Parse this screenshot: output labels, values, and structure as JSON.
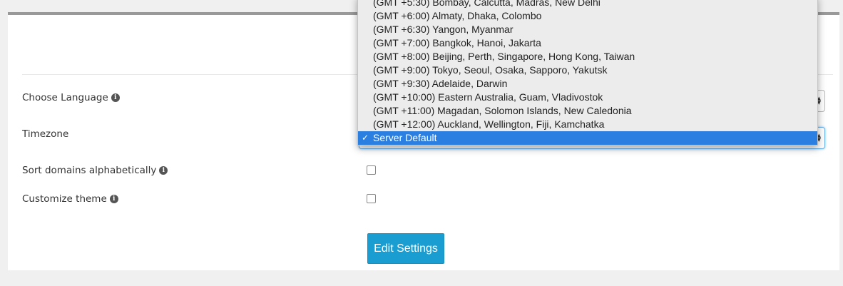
{
  "settings": {
    "language_label": "Choose Language",
    "timezone_label": "Timezone",
    "sort_domains_label": "Sort domains alphabetically",
    "customize_theme_label": "Customize theme",
    "sort_domains_checked": false,
    "customize_theme_checked": false,
    "submit_label": "Edit Settings"
  },
  "timezone_dropdown": {
    "options": [
      "(GMT +5:30) Bombay, Calcutta, Madras, New Delhi",
      "(GMT +6:00) Almaty, Dhaka, Colombo",
      "(GMT +6:30) Yangon, Myanmar",
      "(GMT +7:00) Bangkok, Hanoi, Jakarta",
      "(GMT +8:00) Beijing, Perth, Singapore, Hong Kong, Taiwan",
      "(GMT +9:00) Tokyo, Seoul, Osaka, Sapporo, Yakutsk",
      "(GMT +9:30) Adelaide, Darwin",
      "(GMT +10:00) Eastern Australia, Guam, Vladivostok",
      "(GMT +11:00) Magadan, Solomon Islands, New Caledonia",
      "(GMT +12:00) Auckland, Wellington, Fiji, Kamchatka",
      "Server Default"
    ],
    "selected": "Server Default",
    "check_mark": "✓"
  },
  "colors": {
    "accent": "#1a9dd0",
    "selection": "#2a7fe1"
  }
}
